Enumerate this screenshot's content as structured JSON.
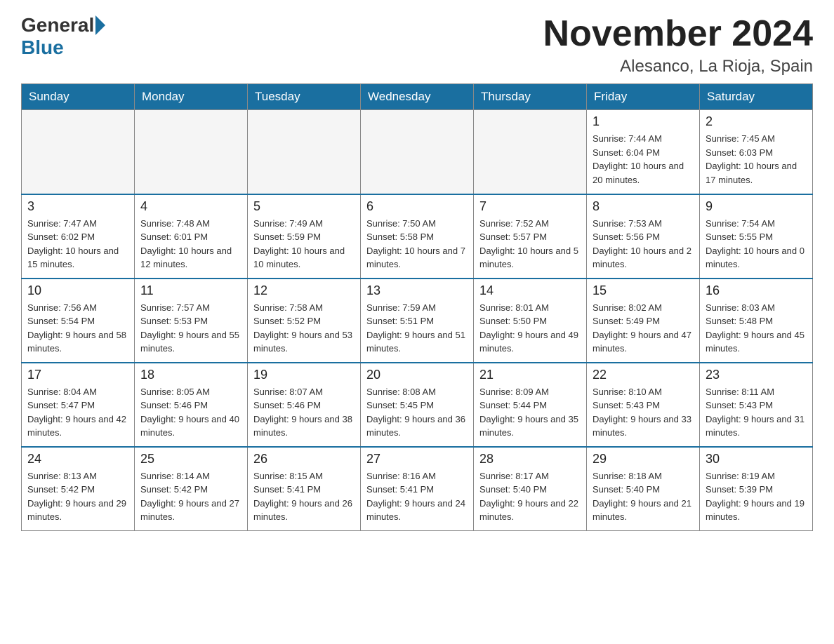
{
  "header": {
    "logo": {
      "general": "General",
      "blue": "Blue"
    },
    "title": "November 2024",
    "location": "Alesanco, La Rioja, Spain"
  },
  "weekdays": [
    "Sunday",
    "Monday",
    "Tuesday",
    "Wednesday",
    "Thursday",
    "Friday",
    "Saturday"
  ],
  "weeks": [
    [
      {
        "day": "",
        "info": ""
      },
      {
        "day": "",
        "info": ""
      },
      {
        "day": "",
        "info": ""
      },
      {
        "day": "",
        "info": ""
      },
      {
        "day": "",
        "info": ""
      },
      {
        "day": "1",
        "info": "Sunrise: 7:44 AM\nSunset: 6:04 PM\nDaylight: 10 hours and 20 minutes."
      },
      {
        "day": "2",
        "info": "Sunrise: 7:45 AM\nSunset: 6:03 PM\nDaylight: 10 hours and 17 minutes."
      }
    ],
    [
      {
        "day": "3",
        "info": "Sunrise: 7:47 AM\nSunset: 6:02 PM\nDaylight: 10 hours and 15 minutes."
      },
      {
        "day": "4",
        "info": "Sunrise: 7:48 AM\nSunset: 6:01 PM\nDaylight: 10 hours and 12 minutes."
      },
      {
        "day": "5",
        "info": "Sunrise: 7:49 AM\nSunset: 5:59 PM\nDaylight: 10 hours and 10 minutes."
      },
      {
        "day": "6",
        "info": "Sunrise: 7:50 AM\nSunset: 5:58 PM\nDaylight: 10 hours and 7 minutes."
      },
      {
        "day": "7",
        "info": "Sunrise: 7:52 AM\nSunset: 5:57 PM\nDaylight: 10 hours and 5 minutes."
      },
      {
        "day": "8",
        "info": "Sunrise: 7:53 AM\nSunset: 5:56 PM\nDaylight: 10 hours and 2 minutes."
      },
      {
        "day": "9",
        "info": "Sunrise: 7:54 AM\nSunset: 5:55 PM\nDaylight: 10 hours and 0 minutes."
      }
    ],
    [
      {
        "day": "10",
        "info": "Sunrise: 7:56 AM\nSunset: 5:54 PM\nDaylight: 9 hours and 58 minutes."
      },
      {
        "day": "11",
        "info": "Sunrise: 7:57 AM\nSunset: 5:53 PM\nDaylight: 9 hours and 55 minutes."
      },
      {
        "day": "12",
        "info": "Sunrise: 7:58 AM\nSunset: 5:52 PM\nDaylight: 9 hours and 53 minutes."
      },
      {
        "day": "13",
        "info": "Sunrise: 7:59 AM\nSunset: 5:51 PM\nDaylight: 9 hours and 51 minutes."
      },
      {
        "day": "14",
        "info": "Sunrise: 8:01 AM\nSunset: 5:50 PM\nDaylight: 9 hours and 49 minutes."
      },
      {
        "day": "15",
        "info": "Sunrise: 8:02 AM\nSunset: 5:49 PM\nDaylight: 9 hours and 47 minutes."
      },
      {
        "day": "16",
        "info": "Sunrise: 8:03 AM\nSunset: 5:48 PM\nDaylight: 9 hours and 45 minutes."
      }
    ],
    [
      {
        "day": "17",
        "info": "Sunrise: 8:04 AM\nSunset: 5:47 PM\nDaylight: 9 hours and 42 minutes."
      },
      {
        "day": "18",
        "info": "Sunrise: 8:05 AM\nSunset: 5:46 PM\nDaylight: 9 hours and 40 minutes."
      },
      {
        "day": "19",
        "info": "Sunrise: 8:07 AM\nSunset: 5:46 PM\nDaylight: 9 hours and 38 minutes."
      },
      {
        "day": "20",
        "info": "Sunrise: 8:08 AM\nSunset: 5:45 PM\nDaylight: 9 hours and 36 minutes."
      },
      {
        "day": "21",
        "info": "Sunrise: 8:09 AM\nSunset: 5:44 PM\nDaylight: 9 hours and 35 minutes."
      },
      {
        "day": "22",
        "info": "Sunrise: 8:10 AM\nSunset: 5:43 PM\nDaylight: 9 hours and 33 minutes."
      },
      {
        "day": "23",
        "info": "Sunrise: 8:11 AM\nSunset: 5:43 PM\nDaylight: 9 hours and 31 minutes."
      }
    ],
    [
      {
        "day": "24",
        "info": "Sunrise: 8:13 AM\nSunset: 5:42 PM\nDaylight: 9 hours and 29 minutes."
      },
      {
        "day": "25",
        "info": "Sunrise: 8:14 AM\nSunset: 5:42 PM\nDaylight: 9 hours and 27 minutes."
      },
      {
        "day": "26",
        "info": "Sunrise: 8:15 AM\nSunset: 5:41 PM\nDaylight: 9 hours and 26 minutes."
      },
      {
        "day": "27",
        "info": "Sunrise: 8:16 AM\nSunset: 5:41 PM\nDaylight: 9 hours and 24 minutes."
      },
      {
        "day": "28",
        "info": "Sunrise: 8:17 AM\nSunset: 5:40 PM\nDaylight: 9 hours and 22 minutes."
      },
      {
        "day": "29",
        "info": "Sunrise: 8:18 AM\nSunset: 5:40 PM\nDaylight: 9 hours and 21 minutes."
      },
      {
        "day": "30",
        "info": "Sunrise: 8:19 AM\nSunset: 5:39 PM\nDaylight: 9 hours and 19 minutes."
      }
    ]
  ]
}
